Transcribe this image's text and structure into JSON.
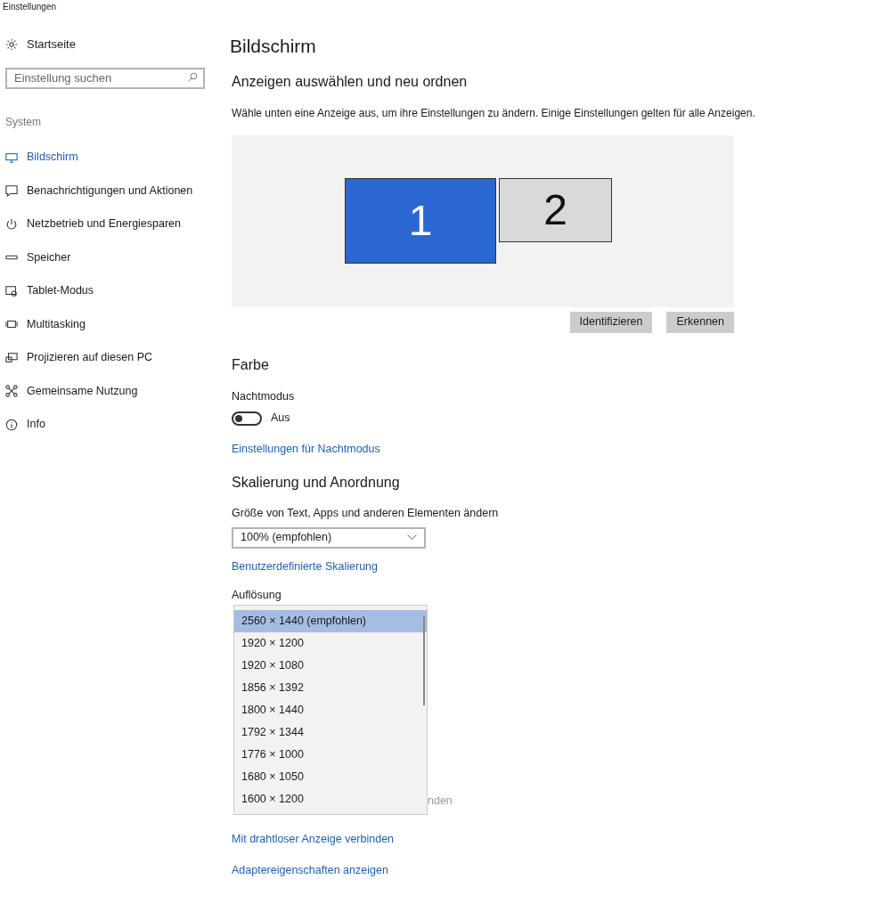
{
  "window": {
    "title": "Einstellungen"
  },
  "sidebar": {
    "home": "Startseite",
    "search": {
      "placeholder": "Einstellung suchen"
    },
    "section": "System",
    "items": [
      {
        "kind": "display",
        "label": "Bildschirm",
        "selected": true
      },
      {
        "kind": "notifications",
        "label": "Benachrichtigungen und Aktionen",
        "selected": false
      },
      {
        "kind": "power",
        "label": "Netzbetrieb und Energiesparen",
        "selected": false
      },
      {
        "kind": "storage",
        "label": "Speicher",
        "selected": false
      },
      {
        "kind": "tablet",
        "label": "Tablet-Modus",
        "selected": false
      },
      {
        "kind": "multitasking",
        "label": "Multitasking",
        "selected": false
      },
      {
        "kind": "project",
        "label": "Projizieren auf diesen PC",
        "selected": false
      },
      {
        "kind": "share",
        "label": "Gemeinsame Nutzung",
        "selected": false
      },
      {
        "kind": "info",
        "label": "Info",
        "selected": false
      }
    ]
  },
  "page": {
    "title": "Bildschirm",
    "arrange_heading": "Anzeigen auswählen und neu ordnen",
    "arrange_text": "Wähle unten eine Anzeige aus, um ihre Einstellungen zu ändern. Einige Einstellungen gelten für alle Anzeigen.",
    "monitors": [
      {
        "label": "1",
        "selected": true
      },
      {
        "label": "2",
        "selected": false
      }
    ],
    "buttons": [
      "Identifizieren",
      "Erkennen"
    ],
    "color_heading": "Farbe",
    "night_label": "Nachtmodus",
    "night_toggle": {
      "on": false,
      "text": "Aus"
    },
    "night_link": "Einstellungen für Nachtmodus",
    "scale_heading": "Skalierung und Anordnung",
    "scale_label": "Größe von Text, Apps und anderen Elementen ändern",
    "scale_value": "100% (empfohlen)",
    "scale_link": "Benutzerdefinierte Skalierung",
    "resolution_label": "Auflösung",
    "resolution_options": [
      {
        "label": "2560 × 1440 (empfohlen)",
        "selected": true
      },
      {
        "label": "1920 × 1200",
        "selected": false
      },
      {
        "label": "1920 × 1080",
        "selected": false
      },
      {
        "label": "1856 × 1392",
        "selected": false
      },
      {
        "label": "1800 × 1440",
        "selected": false
      },
      {
        "label": "1792 × 1344",
        "selected": false
      },
      {
        "label": "1776 × 1000",
        "selected": false
      },
      {
        "label": "1680 × 1050",
        "selected": false
      },
      {
        "label": "1600 × 1200",
        "selected": false
      }
    ],
    "covered_link": "nden",
    "links": [
      "Mit drahtloser Anzeige verbinden",
      "Adaptereigenschaften anzeigen"
    ]
  }
}
